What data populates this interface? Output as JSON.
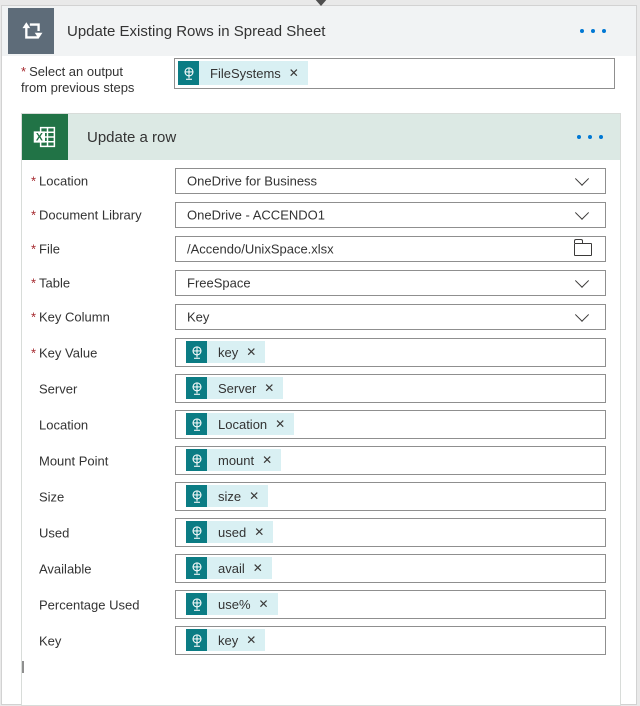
{
  "ui": {
    "required_marker": "*",
    "remove_glyph": "✕"
  },
  "icons": {
    "loop_icon": "apply-to-each loop glyph (white rectangle with up/down arrows)",
    "excel_icon": "Excel spreadsheet logo (white X box over grid on green)",
    "dynamic_content_icon": "teal globe-on-stand dynamic content token icon",
    "chevron_down_icon": "⌄",
    "folder_icon": "file picker folder outline",
    "menu_icon": "• • •"
  },
  "colors": {
    "excel_green": "#217346",
    "token_teal": "#0b7c84",
    "token_pill_bg": "#d9f0f3",
    "menu_dots_blue": "#0078d4",
    "required_red": "#a4262c",
    "loop_icon_bg": "#5e6c79",
    "outer_header_bg": "#f1f3f4",
    "excel_header_bg": "#dce9e4"
  },
  "outer": {
    "title": "Update Existing Rows in Spread Sheet",
    "output_field": {
      "label_line1": "Select an output",
      "label_line2": "from previous steps",
      "required": true,
      "token": "FileSystems"
    }
  },
  "excel": {
    "title": "Update a row",
    "fields": [
      {
        "label": "Location",
        "required": true,
        "type": "dropdown",
        "value": "OneDrive for Business"
      },
      {
        "label": "Document Library",
        "required": true,
        "type": "dropdown",
        "value": "OneDrive - ACCENDO1"
      },
      {
        "label": "File",
        "required": true,
        "type": "file",
        "value": "/Accendo/UnixSpace.xlsx"
      },
      {
        "label": "Table",
        "required": true,
        "type": "dropdown",
        "value": "FreeSpace"
      },
      {
        "label": "Key Column",
        "required": true,
        "type": "dropdown",
        "value": "Key"
      },
      {
        "label": "Key Value",
        "required": true,
        "type": "token",
        "token": "key"
      },
      {
        "label": "Server",
        "required": false,
        "type": "token",
        "token": "Server"
      },
      {
        "label": "Location",
        "required": false,
        "type": "token",
        "token": "Location"
      },
      {
        "label": "Mount Point",
        "required": false,
        "type": "token",
        "token": "mount"
      },
      {
        "label": "Size",
        "required": false,
        "type": "token",
        "token": "size"
      },
      {
        "label": "Used",
        "required": false,
        "type": "token",
        "token": "used"
      },
      {
        "label": "Available",
        "required": false,
        "type": "token",
        "token": "avail"
      },
      {
        "label": "Percentage Used",
        "required": false,
        "type": "token",
        "token": "use%"
      },
      {
        "label": "Key",
        "required": false,
        "type": "token",
        "token": "key"
      }
    ]
  }
}
